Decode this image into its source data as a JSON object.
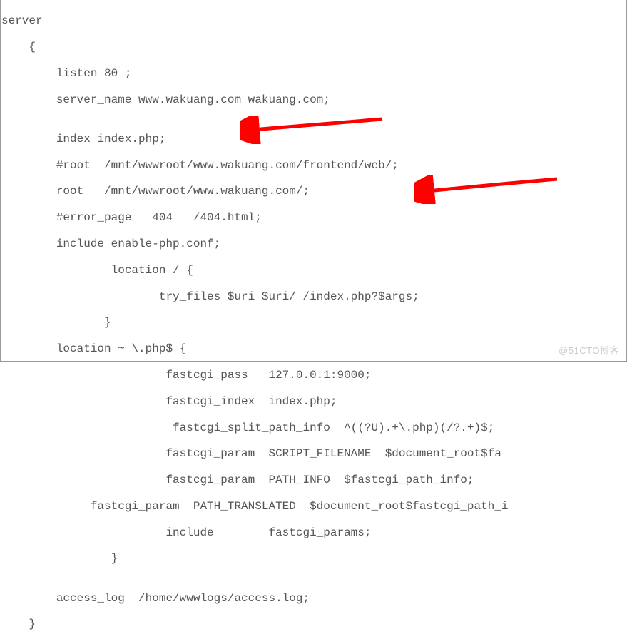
{
  "code": {
    "lines": [
      "server",
      "    {",
      "        listen 80 ;",
      "        server_name www.wakuang.com wakuang.com;",
      "",
      "        index index.php;",
      "        #root  /mnt/wwwroot/www.wakuang.com/frontend/web/;",
      "        root   /mnt/wwwroot/www.wakuang.com/;",
      "        #error_page   404   /404.html;",
      "        include enable-php.conf;",
      "                location / {",
      "                       try_files $uri $uri/ /index.php?$args;",
      "               }",
      "        location ~ \\.php$ {",
      "                        fastcgi_pass   127.0.0.1:9000;",
      "                        fastcgi_index  index.php;",
      "                         fastcgi_split_path_info  ^((?U).+\\.php)(/?.+)$;",
      "                        fastcgi_param  SCRIPT_FILENAME  $document_root$fa",
      "                        fastcgi_param  PATH_INFO  $fastcgi_path_info;",
      "             fastcgi_param  PATH_TRANSLATED  $document_root$fastcgi_path_i",
      "                        include        fastcgi_params;",
      "                }",
      "",
      "        access_log  /home/wwwlogs/access.log;",
      "    }"
    ]
  },
  "annotations": {
    "arrow1": {
      "target": "include enable-php.conf;"
    },
    "arrow2": {
      "target": "location ~ \\.php$ {"
    }
  },
  "watermark": "@51CTO博客"
}
